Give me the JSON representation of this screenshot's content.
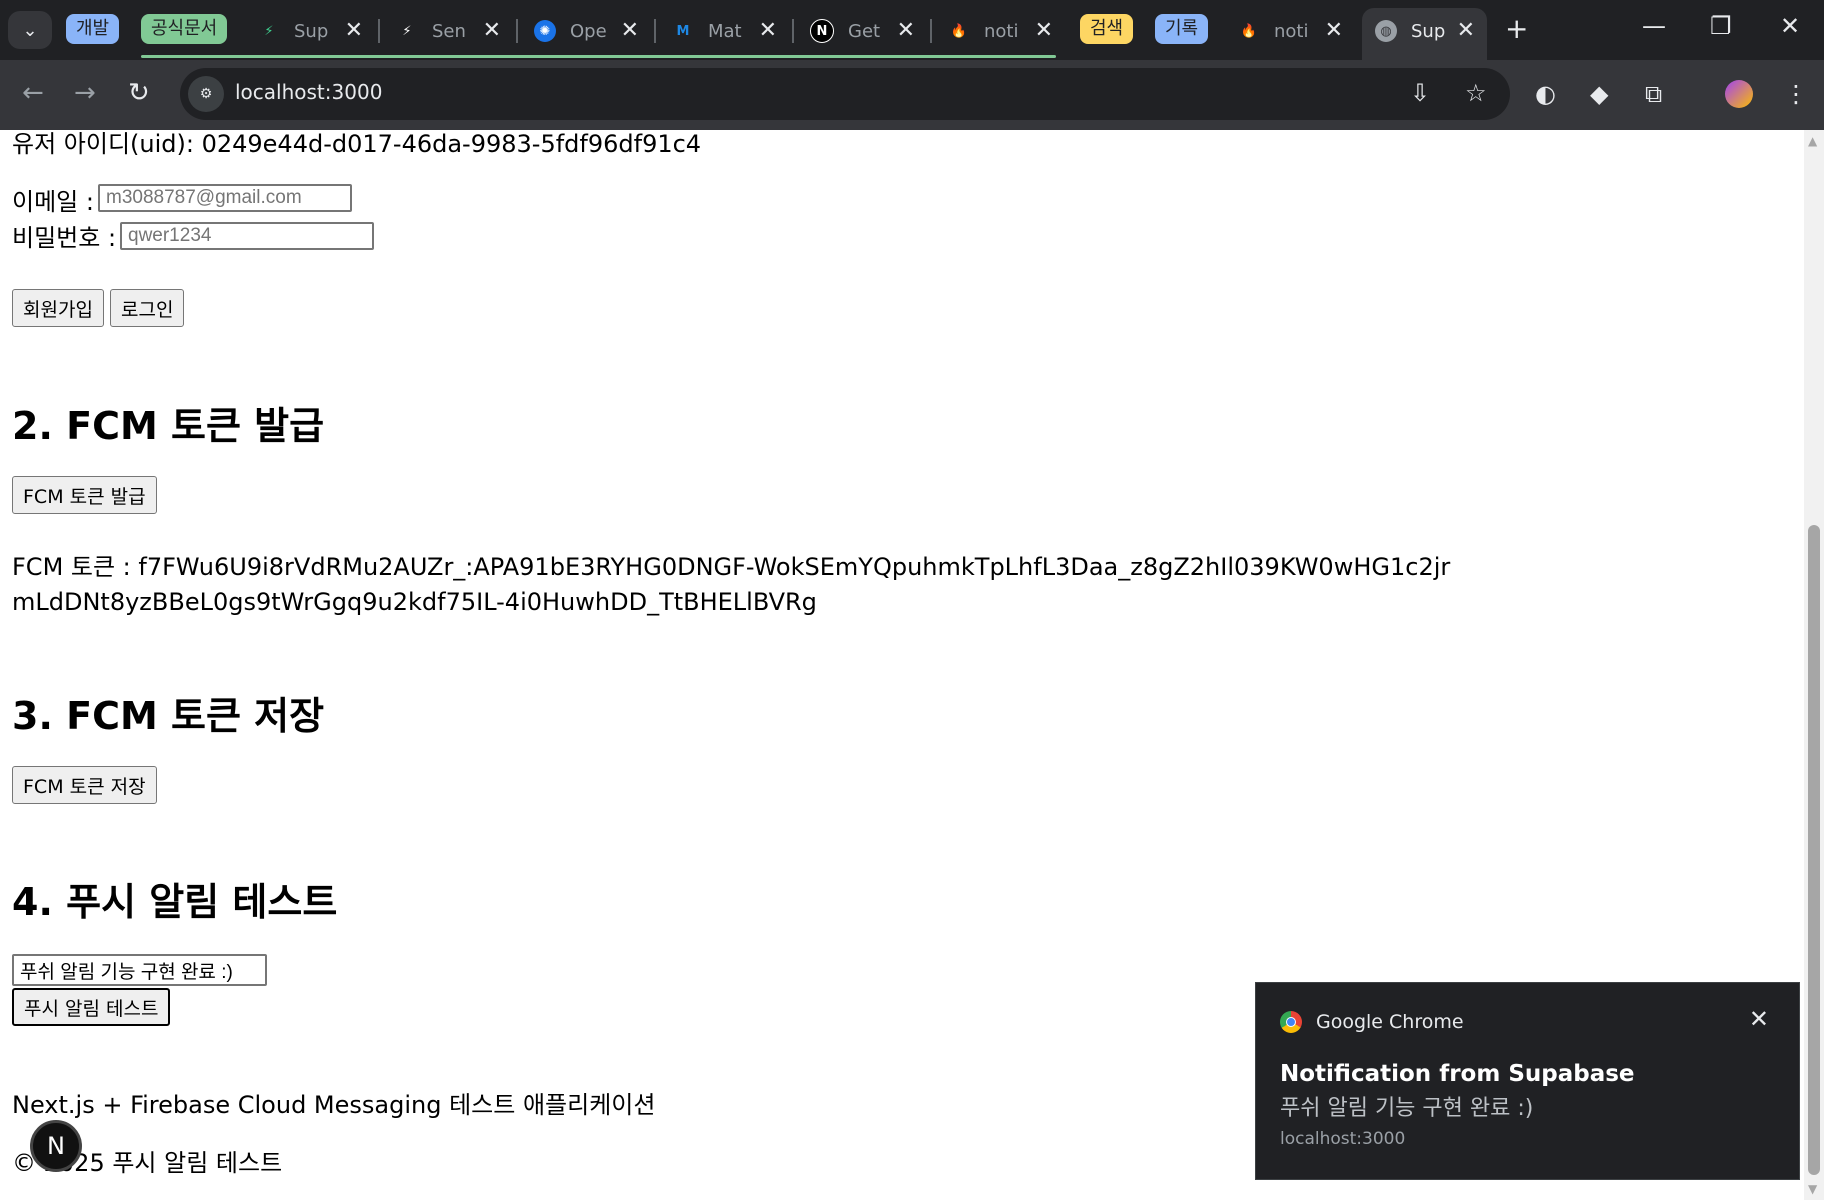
{
  "browser": {
    "tab_groups": [
      {
        "label": "개발",
        "color": "#8ab4f8"
      },
      {
        "label": "공식문서",
        "color": "#81c995"
      },
      {
        "label": "검색",
        "color": "#fdd663"
      },
      {
        "label": "기록",
        "color": "#8ab4f8"
      }
    ],
    "tabs": [
      {
        "label": "Sup",
        "icon": "supabase-icon"
      },
      {
        "label": "Sen",
        "icon": "bolt-icon"
      },
      {
        "label": "Ope",
        "icon": "openai-icon"
      },
      {
        "label": "Mat",
        "icon": "mui-icon"
      },
      {
        "label": "Get",
        "icon": "nextjs-icon"
      },
      {
        "label": "noti",
        "icon": "firebase-icon"
      },
      {
        "label": "noti",
        "icon": "firebase-icon"
      },
      {
        "label": "Sup",
        "icon": "globe-icon",
        "active": true
      }
    ],
    "url": "localhost:3000"
  },
  "page": {
    "uid_text": "유저 아이디(uid): 0249e44d-d017-46da-9983-5fdf96df91c4",
    "email_label": "이메일 :",
    "email_placeholder": "m3088787@gmail.com",
    "password_label": "비밀번호 :",
    "password_placeholder": "qwer1234",
    "signup_button": "회원가입",
    "login_button": "로그인",
    "section2_title": "2. FCM 토큰 발급",
    "issue_token_button": "FCM 토큰 발급",
    "token_text": "FCM 토큰 : f7FWu6U9i8rVdRMu2AUZr_:APA91bE3RYHG0DNGF-WokSEmYQpuhmkTpLhfL3Daa_z8gZ2hIl039KW0wHG1c2jrmLdDNt8yzBBeL0gs9tWrGgq9u2kdf75IL-4i0HuwhDD_TtBHELlBVRg",
    "section3_title": "3. FCM 토큰 저장",
    "save_token_button": "FCM 토큰 저장",
    "section4_title": "4. 푸시 알림 테스트",
    "push_message_value": "푸쉬 알림 기능 구현 완료 :)",
    "push_test_button": "푸시 알림 테스트",
    "footer_text": "Next.js + Firebase Cloud Messaging 테스트 애플리케이션",
    "copyright_text": "© 2025 푸시 알림 테스트",
    "next_badge": "N"
  },
  "notification": {
    "app": "Google Chrome",
    "title": "Notification from Supabase",
    "body": "푸쉬 알림 기능 구현 완료 :)",
    "origin": "localhost:3000"
  }
}
